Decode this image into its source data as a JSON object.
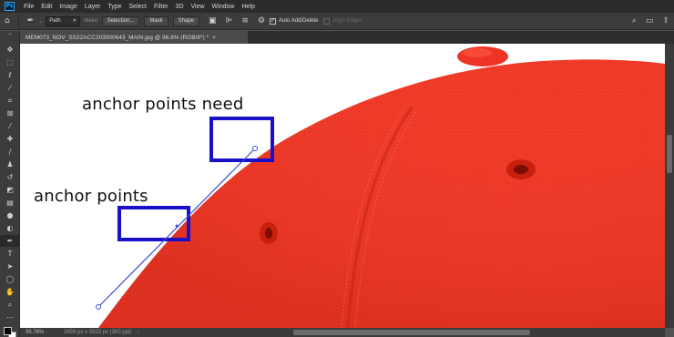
{
  "app": {
    "logo": "Ps",
    "menu": [
      "File",
      "Edit",
      "Image",
      "Layer",
      "Type",
      "Select",
      "Filter",
      "3D",
      "View",
      "Window",
      "Help"
    ]
  },
  "options_bar": {
    "mode_value": "Path",
    "make_label": "Make:",
    "buttons": [
      "Selection...",
      "Mask",
      "Shape"
    ],
    "auto_add_delete": {
      "label": "Auto Add/Delete",
      "checked": true
    },
    "align_edges": {
      "label": "Align Edges",
      "checked": false,
      "disabled": true
    }
  },
  "document": {
    "tab_title": "MEM073_NOV_SS22ACC203000643_MAIN.jpg @ 96.8% (RGB/8*) *",
    "close_glyph": "×"
  },
  "annotations": {
    "label_upper": "anchor points  need",
    "label_lower": "anchor points",
    "box_color": "#1a10c8",
    "path_color": "#3a4fd0"
  },
  "status": {
    "zoom": "96.76%",
    "info": "2659 px x 3323 px (300 ppi)",
    "arrow": "›"
  },
  "colors": {
    "cap_red": "#f03a28",
    "foreground": "#000000",
    "background": "#ffffff"
  },
  "toolbar_icons": [
    "move-icon",
    "marquee-icon",
    "lasso-icon",
    "quick-select-icon",
    "crop-icon",
    "frame-icon",
    "eyedropper-icon",
    "healing-brush-icon",
    "brush-icon",
    "clone-stamp-icon",
    "history-brush-icon",
    "eraser-icon",
    "gradient-icon",
    "blur-icon",
    "dodge-icon",
    "pen-icon",
    "type-icon",
    "path-selection-icon",
    "shape-icon",
    "hand-icon",
    "zoom-icon",
    "more-tools-icon"
  ]
}
